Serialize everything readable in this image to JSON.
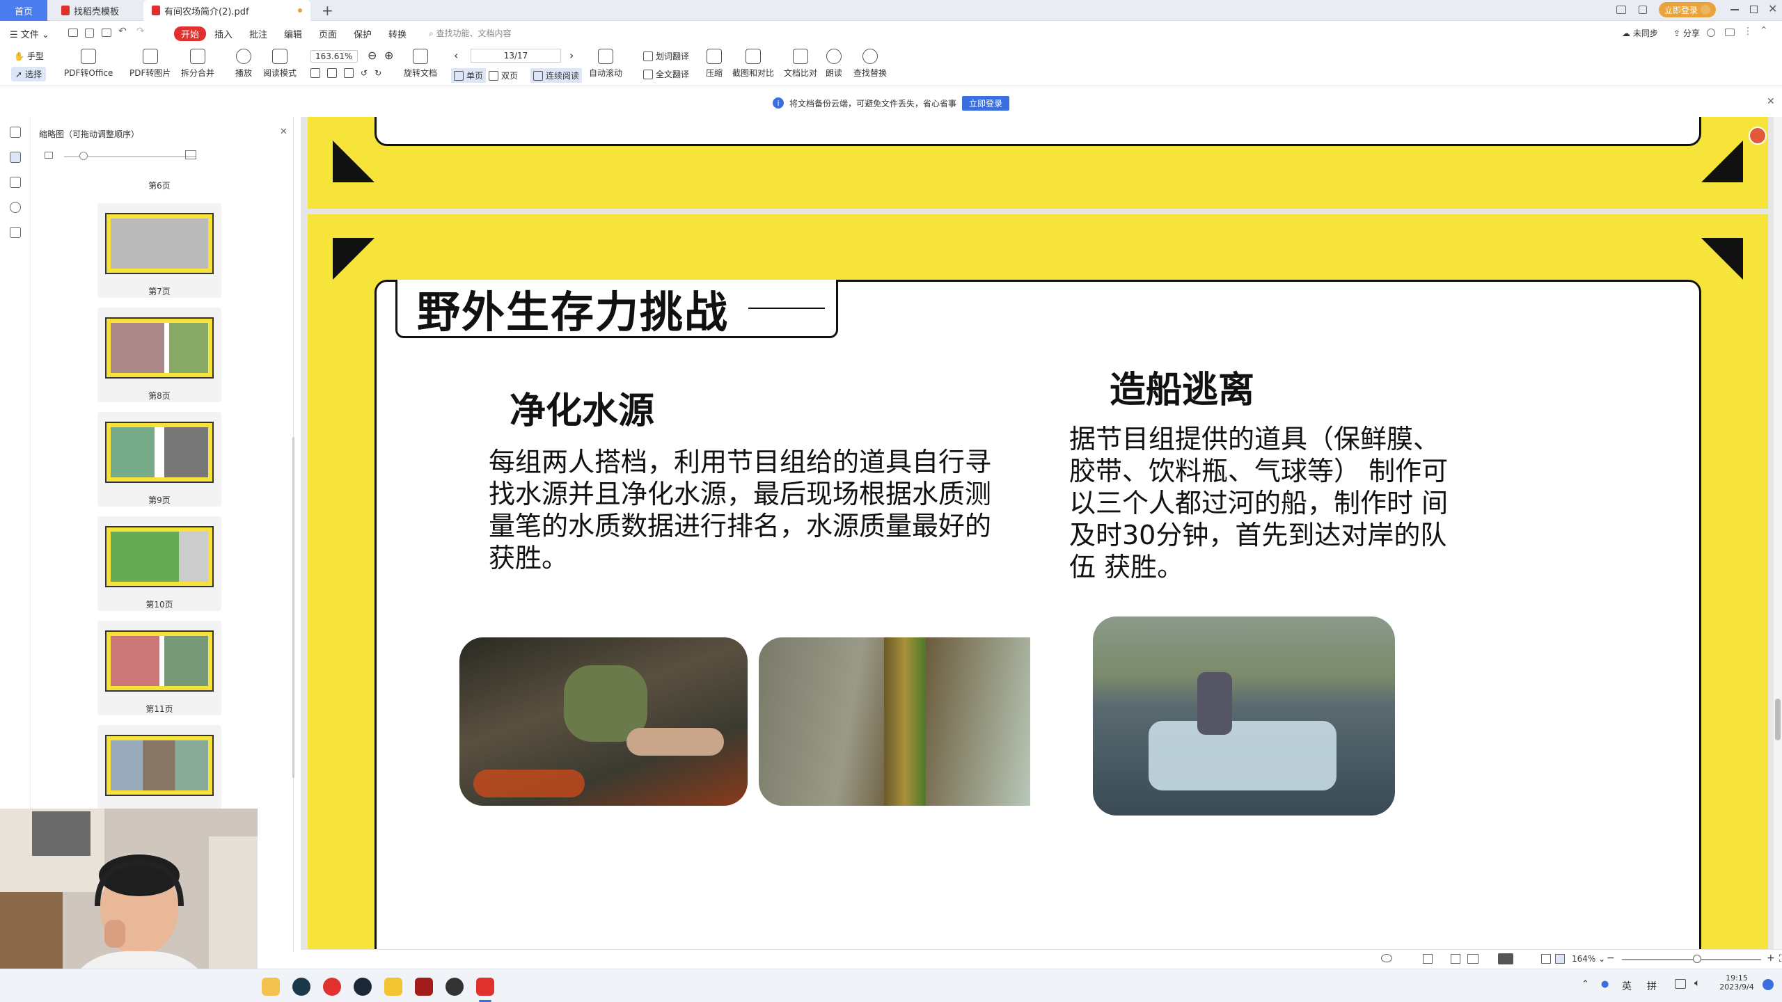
{
  "titlebar": {
    "tabs": [
      {
        "label": "首页"
      },
      {
        "label": "找稻壳模板"
      },
      {
        "label": "有间农场简介(2).pdf"
      }
    ],
    "add_tab": "+",
    "login_label": "立即登录"
  },
  "menubar": {
    "file_label": "文件",
    "items": [
      "开始",
      "插入",
      "批注",
      "编辑",
      "页面",
      "保护",
      "转换"
    ],
    "search_placeholder": "查找功能、文档内容",
    "right": [
      "未同步",
      "分享"
    ]
  },
  "toolbar": {
    "hand": "手型",
    "select": "选择",
    "pdf_to_office": "PDF转Office",
    "pdf_to_image": "PDF转图片",
    "split_merge": "拆分合并",
    "play": "播放",
    "read_mode": "阅读模式",
    "zoom_value": "163.61%",
    "rotate": "旋转文档",
    "page_value": "13/17",
    "single": "单页",
    "double": "双页",
    "continuous": "连续阅读",
    "auto_scroll": "自动滚动",
    "translate_words": "划词翻译",
    "translate_full": "全文翻译",
    "compress": "压缩",
    "screenshot_compare": "截图和对比",
    "doc_compare": "文档比对",
    "read_aloud": "朗读",
    "find_replace": "查找替换"
  },
  "notice": {
    "text": "将文档备份云端，可避免文件丢失，省心省事",
    "button": "立即登录"
  },
  "thumbnails": {
    "panel_title": "缩略图（可拖动调整顺序）",
    "pages": [
      {
        "label": "第6页"
      },
      {
        "label": "第7页"
      },
      {
        "label": "第8页"
      },
      {
        "label": "第9页"
      },
      {
        "label": "第10页"
      },
      {
        "label": "第11页"
      },
      {
        "label": ""
      }
    ]
  },
  "slide": {
    "title": "野外生存力挑战",
    "left": {
      "heading": "净化水源",
      "body": "每组两人搭档，利用节目组给的道具自行寻找水源并且净化水源，最后现场根据水质测量笔的水质数据进行排名，水源质量最好的获胜。"
    },
    "right": {
      "heading": "造船逃离",
      "body": "据节目组提供的道具（保鲜膜、胶带、饮料瓶、气球等） 制作可以三个人都过河的船，制作时 间及时30分钟，首先到达对岸的队伍 获胜。"
    }
  },
  "statusbar": {
    "zoom": "164%"
  },
  "taskbar": {
    "ime_lang": "英",
    "ime_mode": "拼",
    "time": "19:15",
    "date": "2023/9/4"
  },
  "colors": {
    "accent_blue": "#4a7cf0",
    "brand_red": "#e0312e",
    "slide_yellow": "#f7e43a"
  }
}
